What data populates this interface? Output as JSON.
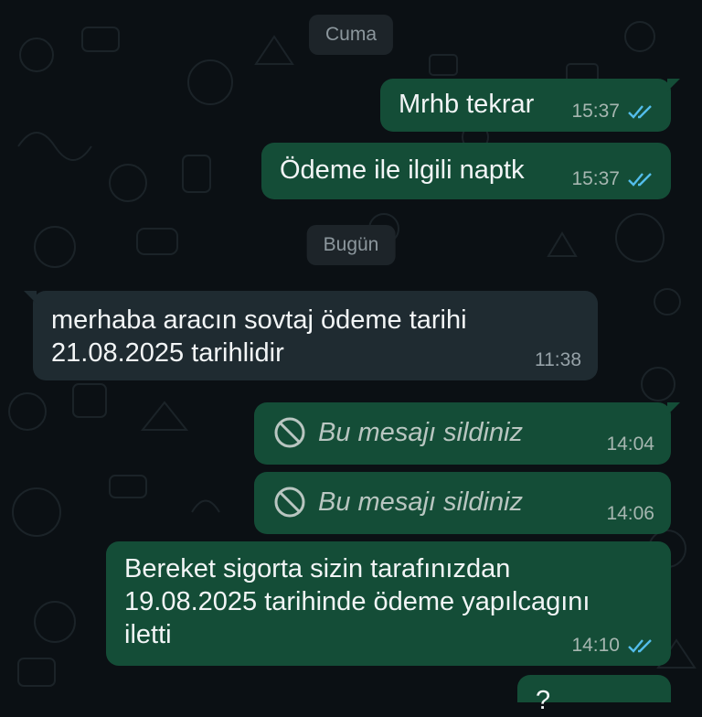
{
  "days": {
    "first": "Cuma",
    "second": "Bugün"
  },
  "messages": [
    {
      "id": "m1",
      "direction": "outgoing",
      "text": "Mrhb tekrar",
      "time": "15:37",
      "status": "read"
    },
    {
      "id": "m2",
      "direction": "outgoing",
      "text": "Ödeme ile ilgili naptk",
      "time": "15:37",
      "status": "read"
    },
    {
      "id": "m3",
      "direction": "incoming",
      "lines": [
        "merhaba aracın sovtaj ödeme tarihi",
        "21.08.2025 tarihlidir"
      ],
      "time": "11:38"
    },
    {
      "id": "m4",
      "direction": "outgoing",
      "deleted": true,
      "text": "Bu mesajı sildiniz",
      "time": "14:04"
    },
    {
      "id": "m5",
      "direction": "outgoing",
      "deleted": true,
      "text": "Bu mesajı sildiniz",
      "time": "14:06"
    },
    {
      "id": "m6",
      "direction": "outgoing",
      "lines": [
        "Bereket sigorta sizin tarafınızdan",
        "19.08.2025 tarihinde ödeme yapılcagını",
        "iletti"
      ],
      "time": "14:10",
      "status": "read"
    },
    {
      "id": "m7",
      "direction": "outgoing",
      "text": "?",
      "partial": true
    }
  ],
  "colors": {
    "background": "#0b1014",
    "outgoing_bubble": "#144d37",
    "incoming_bubble": "#1f2b31",
    "read_tick": "#53bdeb",
    "day_chip": "#1d2429"
  },
  "icons": {
    "read_status": "double-check-icon",
    "deleted": "ban-icon"
  }
}
